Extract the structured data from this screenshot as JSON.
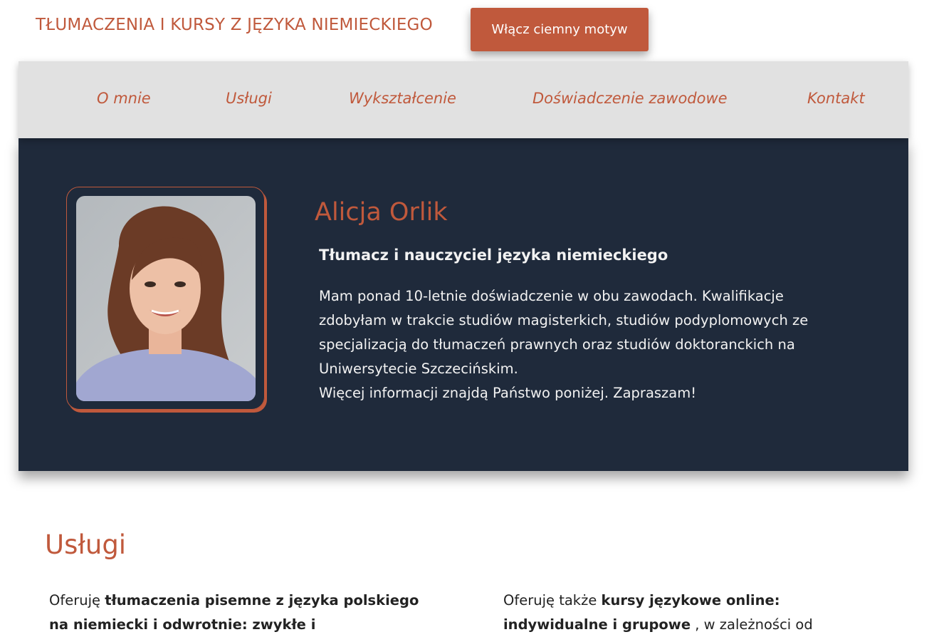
{
  "header": {
    "site_title": "TŁUMACZENIA I KURSY Z JĘZYKA NIEMIECKIEGO",
    "theme_button_label": "Włącz ciemny motyw"
  },
  "nav": {
    "items": [
      {
        "label": "O mnie"
      },
      {
        "label": "Usługi"
      },
      {
        "label": "Wykształcenie"
      },
      {
        "label": "Doświadczenie zawodowe"
      },
      {
        "label": "Kontakt"
      }
    ]
  },
  "hero": {
    "photo_alt": "Alicja Orlik",
    "name": "Alicja Orlik",
    "subtitle": "Tłumacz i nauczyciel języka niemieckiego",
    "bio_paragraph": "Mam ponad 10-letnie doświadczenie w obu zawodach. Kwalifikacje zdobyłam w trakcie studiów magisterkich, studiów podyplomowych ze specjalizacją do tłumaczeń prawnych oraz studiów doktoranckich na Uniwersytecie Szczecińskim.",
    "bio_closing": "Więcej informacji znajdą Państwo poniżej. Zapraszam!"
  },
  "services": {
    "heading": "Usługi",
    "left": {
      "prefix": "Oferuję ",
      "bold": "tłumaczenia pisemne z języka polskiego na niemiecki i odwrotnie: zwykłe i"
    },
    "right": {
      "prefix": "Oferuję także ",
      "bold": "kursy językowe online: indywidualne i grupowe",
      "suffix": " , w zależności od"
    }
  },
  "colors": {
    "accent": "#c0593c",
    "hero_bg": "#1f2a3b",
    "nav_bg": "#e1e1e1"
  }
}
